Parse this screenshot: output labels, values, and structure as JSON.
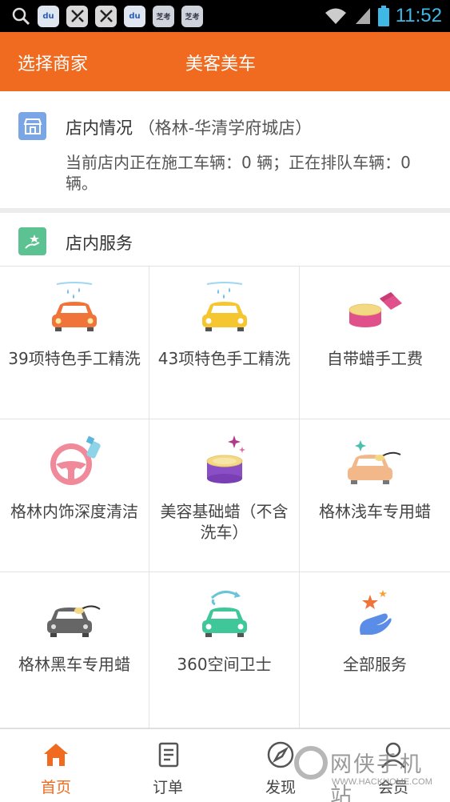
{
  "status_bar": {
    "time": "11:52",
    "apps": [
      {
        "name": "search-icon"
      },
      {
        "name": "baidu-app-icon",
        "text": "du"
      },
      {
        "name": "tool-app-icon-1"
      },
      {
        "name": "tool-app-icon-2"
      },
      {
        "name": "baidu-app-icon-2",
        "text": "du"
      },
      {
        "name": "zhikao-app-icon-1",
        "text": "芝考"
      },
      {
        "name": "zhikao-app-icon-2",
        "text": "芝考"
      }
    ],
    "colors": {
      "bg": "#000000",
      "time": "#3fb8e6"
    }
  },
  "header": {
    "left_label": "选择商家",
    "title": "美客美车",
    "color": "#f06a1f"
  },
  "store_status": {
    "title": "店内情况",
    "store_name": "（格林-华清学府城店）",
    "info": "当前店内正在施工车辆：0 辆；正在排队车辆：0 辆。"
  },
  "services": {
    "title": "店内服务",
    "items": [
      {
        "label": "39项特色手工精洗",
        "icon": "car-wash-orange-icon"
      },
      {
        "label": "43项特色手工精洗",
        "icon": "car-wash-yellow-icon"
      },
      {
        "label": "自带蜡手工费",
        "icon": "wax-jar-icon"
      },
      {
        "label": "格林内饰深度清洁",
        "icon": "steering-wheel-spray-icon"
      },
      {
        "label": "美容基础蜡（不含洗车）",
        "icon": "wax-tin-icon"
      },
      {
        "label": "格林浅车专用蜡",
        "icon": "light-car-polish-icon"
      },
      {
        "label": "格林黑车专用蜡",
        "icon": "dark-car-polish-icon"
      },
      {
        "label": "360空间卫士",
        "icon": "car-360-icon"
      },
      {
        "label": "全部服务",
        "icon": "all-services-icon"
      }
    ]
  },
  "bottom_nav": {
    "items": [
      {
        "label": "首页",
        "icon": "home-icon",
        "active": true
      },
      {
        "label": "订单",
        "icon": "orders-icon",
        "active": false
      },
      {
        "label": "发现",
        "icon": "compass-icon",
        "active": false
      },
      {
        "label": "会员",
        "icon": "member-icon",
        "active": false
      }
    ]
  },
  "watermark": {
    "text": "网侠手机站",
    "url": "WWW.HACKHOME.COM"
  }
}
